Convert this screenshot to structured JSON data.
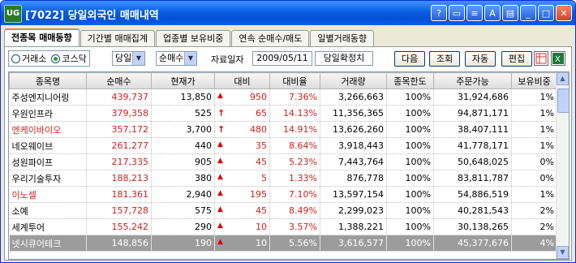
{
  "window": {
    "logo": "UG",
    "title": "[7022] 당일외국인 매매내역",
    "title_buttons": [
      "?",
      "▭",
      "≡",
      "A",
      "▤",
      "_",
      "□",
      "✕"
    ]
  },
  "tabs": [
    {
      "label": "전종목 매매동향",
      "active": true
    },
    {
      "label": "기간별 매매집계",
      "active": false
    },
    {
      "label": "업종별 보유비중",
      "active": false
    },
    {
      "label": "연속 순매수/매도",
      "active": false
    },
    {
      "label": "일별거래동향",
      "active": false
    }
  ],
  "toolbar": {
    "market_options": [
      {
        "label": "거래소",
        "selected": false
      },
      {
        "label": "코스닥",
        "selected": true
      }
    ],
    "period_select": "당일",
    "sort_select": "순매수",
    "date_label": "자료일자",
    "date_value": "2009/05/11",
    "confirm_label": "당일확정치",
    "next_label": "다음",
    "query_label": "조회",
    "auto_label": "자동",
    "edit_label": "편집"
  },
  "table": {
    "columns": [
      "종목명",
      "순매수",
      "현재가",
      "대비",
      "대비율",
      "거래량",
      "종목한도",
      "주문가능",
      "보유비중"
    ],
    "rows": [
      {
        "name": "주성엔지니어링",
        "net": "439,737",
        "price": "13,850",
        "sign": "▲",
        "change": "950",
        "rate": "7.36%",
        "volume": "3,266,663",
        "limit": "100%",
        "orderable": "31,924,686",
        "holding": "1%"
      },
      {
        "name": "우원인프라",
        "net": "379,358",
        "price": "525",
        "sign": "↑",
        "change": "65",
        "rate": "14.13%",
        "volume": "11,356,365",
        "limit": "100%",
        "orderable": "94,871,171",
        "holding": "1%"
      },
      {
        "name": "엔케이바이오",
        "net": "357,172",
        "price": "3,700",
        "sign": "↑",
        "change": "480",
        "rate": "14.91%",
        "volume": "13,626,260",
        "limit": "100%",
        "orderable": "38,407,111",
        "holding": "1%"
      },
      {
        "name": "네오웨이브",
        "net": "261,277",
        "price": "440",
        "sign": "▲",
        "change": "35",
        "rate": "8.64%",
        "volume": "3,918,443",
        "limit": "100%",
        "orderable": "41,778,171",
        "holding": "1%"
      },
      {
        "name": "성원파이프",
        "net": "217,335",
        "price": "905",
        "sign": "▲",
        "change": "45",
        "rate": "5.23%",
        "volume": "7,443,764",
        "limit": "100%",
        "orderable": "50,648,025",
        "holding": "0%"
      },
      {
        "name": "우리기술투자",
        "net": "188,213",
        "price": "380",
        "sign": "▲",
        "change": "5",
        "rate": "1.33%",
        "volume": "876,778",
        "limit": "100%",
        "orderable": "83,811,787",
        "holding": "0%"
      },
      {
        "name": "이노셀",
        "net": "181,361",
        "price": "2,940",
        "sign": "▲",
        "change": "195",
        "rate": "7.10%",
        "volume": "13,597,154",
        "limit": "100%",
        "orderable": "54,886,519",
        "holding": "1%"
      },
      {
        "name": "소예",
        "net": "157,728",
        "price": "575",
        "sign": "▲",
        "change": "45",
        "rate": "8.49%",
        "volume": "2,299,023",
        "limit": "100%",
        "orderable": "40,281,543",
        "holding": "2%"
      },
      {
        "name": "세계투어",
        "net": "155,242",
        "price": "290",
        "sign": "▲",
        "change": "10",
        "rate": "3.57%",
        "volume": "1,388,221",
        "limit": "100%",
        "orderable": "30,138,265",
        "holding": "2%"
      },
      {
        "name": "넷시큐어테크",
        "net": "148,856",
        "price": "190",
        "sign": "▲",
        "change": "10",
        "rate": "5.56%",
        "volume": "3,616,577",
        "limit": "100%",
        "orderable": "45,377,676",
        "holding": "4%"
      }
    ],
    "selected_row": 9
  },
  "colors": {
    "title_bar": "#0a5fe0",
    "up_red": "#d22020",
    "selected_row": "#9c9c9c"
  }
}
